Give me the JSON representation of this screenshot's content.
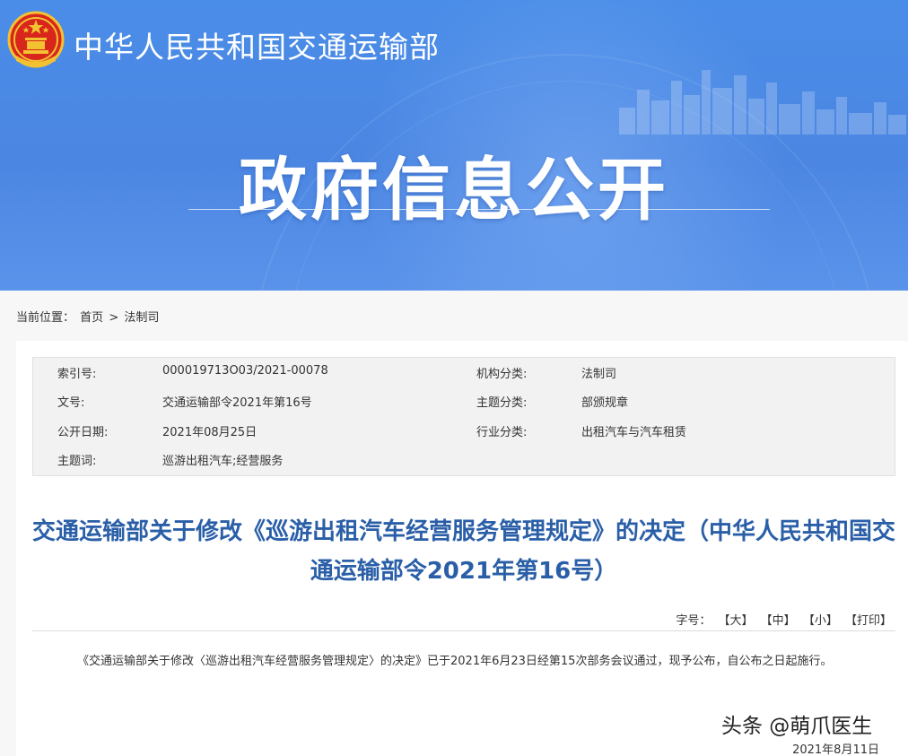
{
  "header": {
    "ministry_name": "中华人民共和国交通运输部",
    "section_title": "政府信息公开"
  },
  "breadcrumb": {
    "label": "当前位置：",
    "home": "首页",
    "separator": ">",
    "current": "法制司"
  },
  "meta": {
    "index_label": "索引号:",
    "index_value": "000019713O03/2021-00078",
    "org_label": "机构分类:",
    "org_value": "法制司",
    "docno_label": "文号:",
    "docno_value": "交通运输部令2021年第16号",
    "topic_label": "主题分类:",
    "topic_value": "部颁规章",
    "date_label": "公开日期:",
    "date_value": "2021年08月25日",
    "industry_label": "行业分类:",
    "industry_value": "出租汽车与汽车租赁",
    "keyword_label": "主题词:",
    "keyword_value": "巡游出租汽车;经营服务"
  },
  "document": {
    "title": "交通运输部关于修改《巡游出租汽车经营服务管理规定》的决定（中华人民共和国交通运输部令2021年第16号）",
    "font_size_label": "字号：",
    "font_large": "【大】",
    "font_medium": "【中】",
    "font_small": "【小】",
    "print": "【打印】",
    "body": "《交通运输部关于修改〈巡游出租汽车经营服务管理规定〉的决定》已于2021年6月23日经第15次部务会议通过，现予公布，自公布之日起施行。",
    "date": "2021年8月11日"
  },
  "watermark": {
    "text": "头条 @萌爪医生"
  },
  "colors": {
    "banner": "#4b86e2",
    "title_blue": "#2a5fa8"
  }
}
